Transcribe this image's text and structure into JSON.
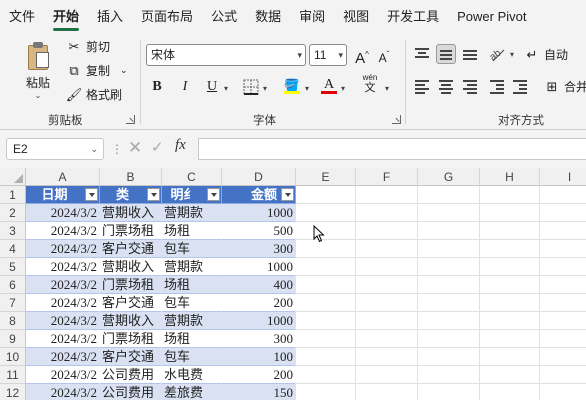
{
  "menu": [
    "文件",
    "开始",
    "插入",
    "页面布局",
    "公式",
    "数据",
    "审阅",
    "视图",
    "开发工具",
    "Power Pivot"
  ],
  "active_menu": "开始",
  "clipboard": {
    "paste": "粘贴",
    "cut": "剪切",
    "copy": "复制",
    "format_painter": "格式刷",
    "group_label": "剪贴板"
  },
  "font": {
    "name": "宋体",
    "size": "11",
    "grow": "A",
    "shrink": "A",
    "bold": "B",
    "italic": "I",
    "underline": "U",
    "phonetic": "wén",
    "phonetic_char": "文",
    "font_color_letter": "A",
    "group_label": "字体",
    "fill_color": "#ffff00",
    "font_color": "#e00000"
  },
  "alignment": {
    "group_label": "对齐方式",
    "wrap": "自动",
    "merge": "合并"
  },
  "formula_bar": {
    "name_box": "E2",
    "fx": "fx",
    "value": ""
  },
  "columns": [
    "A",
    "B",
    "C",
    "D",
    "E",
    "F",
    "G",
    "H",
    "I"
  ],
  "rows": [
    "1",
    "2",
    "3",
    "4",
    "5",
    "6",
    "7",
    "8",
    "9",
    "10",
    "11",
    "12"
  ],
  "table": {
    "headers": [
      "日期",
      "类别",
      "明细",
      "金额"
    ],
    "header_display": [
      "日期",
      "类",
      "明纟",
      "金额"
    ],
    "rows": [
      [
        "2024/3/2",
        "营期收入",
        "营期款",
        "1000"
      ],
      [
        "2024/3/2",
        "门票场租",
        "场租",
        "500"
      ],
      [
        "2024/3/2",
        "客户交通",
        "包车",
        "300"
      ],
      [
        "2024/3/2",
        "营期收入",
        "营期款",
        "1000"
      ],
      [
        "2024/3/2",
        "门票场租",
        "场租",
        "400"
      ],
      [
        "2024/3/2",
        "客户交通",
        "包车",
        "200"
      ],
      [
        "2024/3/2",
        "营期收入",
        "营期款",
        "1000"
      ],
      [
        "2024/3/2",
        "门票场租",
        "场租",
        "300"
      ],
      [
        "2024/3/2",
        "客户交通",
        "包车",
        "100"
      ],
      [
        "2024/3/2",
        "公司费用",
        "水电费",
        "200"
      ],
      [
        "2024/3/2",
        "公司费用",
        "差旅费",
        "150"
      ]
    ]
  },
  "colors": {
    "table_header": "#4472c4",
    "table_band": "#d9e1f2",
    "accent": "#1e7145"
  }
}
